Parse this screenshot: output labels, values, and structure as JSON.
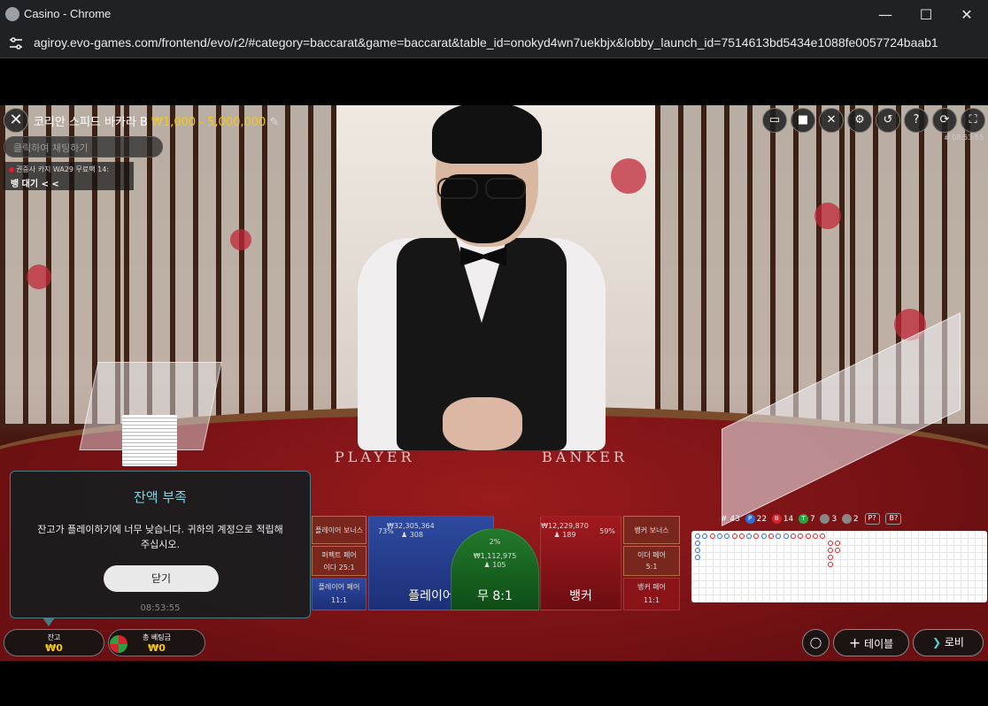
{
  "window": {
    "title": "Casino - Chrome",
    "minimize": "—",
    "maximize": "☐",
    "close": "✕"
  },
  "address": {
    "url": "agiroy.evo-games.com/frontend/evo/r2/#category=baccarat&game=baccarat&table_id=onokyd4wn7uekbjx&lobby_launch_id=7514613bd5434e1088fe0057724baab1"
  },
  "header": {
    "table_name": "코리안 스피드 바카라 B",
    "limits": "₩1,000 - 5,000,000",
    "chat_placeholder": "클릭하여 채팅하기",
    "info_line": "권중사  카지 WA29  무료팩 14:",
    "status": "뱅 대기 < <",
    "game_id": "# 08:53:55"
  },
  "bets": {
    "player_bonus": "플레이어 보너스",
    "player_pair": "플레이어 페어",
    "player_pair_odds": "11:1",
    "perfect_pair": "퍼펙트 페어",
    "either_pair": "이다 25:1",
    "player_total": "₩32,305,364",
    "player_count": "♟ 308",
    "player_pct": "73%",
    "player_label": "플레이어",
    "tie_pct": "2%",
    "tie_total": "₩1,112,975",
    "tie_count": "♟ 105",
    "tie_label": "무 8:1",
    "banker_total": "₩12,229,870",
    "banker_count": "♟ 189",
    "banker_pct": "59%",
    "banker_label": "뱅커",
    "banker_bonus": "뱅커 보너스",
    "either_pair_label": "이더 페어",
    "either_pair_odds": "5:1",
    "banker_pair": "뱅커 페어",
    "banker_pair_odds": "11:1"
  },
  "stats": {
    "rounds": "# 43",
    "player_count": "22",
    "banker_count": "14",
    "tie_count": "7",
    "player_pair_count": "3",
    "banker_pair_count": "2",
    "player_ask": "P?",
    "banker_ask": "B?",
    "colors": {
      "player": "#2f6fd6",
      "banker": "#d8232a",
      "tie": "#2ea043"
    }
  },
  "modal": {
    "title": "잔액 부족",
    "body": "잔고가 플레이하기에 너무 낮습니다. 귀하의 계정으로 적립해 주십시오.",
    "button": "닫기",
    "time": "08:53:55"
  },
  "footer": {
    "balance_label": "잔고",
    "balance_value": "₩0",
    "total_bet_label": "총 베팅금",
    "total_bet_value": "₩0",
    "table_button": "테이블",
    "lobby_button": "로비"
  }
}
